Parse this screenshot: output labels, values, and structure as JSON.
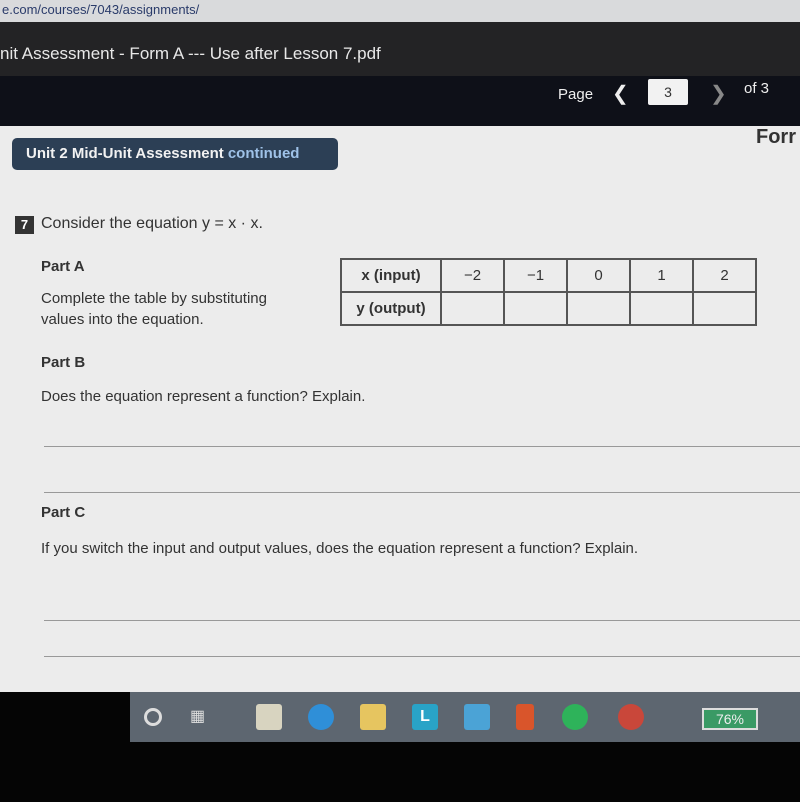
{
  "browser": {
    "url": "e.com/courses/7043/assignments/"
  },
  "viewer": {
    "title": "nit Assessment - Form A --- Use after Lesson 7.pdf",
    "page_label": "Page",
    "current_page": "3",
    "page_total": "of 3"
  },
  "doc": {
    "badge_title": "Unit 2  Mid-Unit Assessment",
    "badge_continued": "continued",
    "form_label": "Forr",
    "question_number": "7",
    "question": "Consider the equation y = x · x.",
    "part_a": {
      "label": "Part A",
      "text": "Complete the table by substituting values into the equation."
    },
    "table": {
      "row1_header": "x (input)",
      "row2_header": "y (output)",
      "x_values": [
        "−2",
        "−1",
        "0",
        "1",
        "2"
      ],
      "y_values": [
        "",
        "",
        "",
        "",
        ""
      ]
    },
    "part_b": {
      "label": "Part B",
      "text": "Does the equation represent a function? Explain."
    },
    "part_c": {
      "label": "Part C",
      "text": "If you switch the input and output values, does the equation represent a function? Explain."
    }
  },
  "taskbar": {
    "icons": [
      "cortana-icon",
      "task-view-icon",
      "store-icon",
      "edge-icon",
      "file-explorer-icon",
      "l-app-icon",
      "mail-icon",
      "office-icon",
      "spotify-icon",
      "chrome-icon"
    ],
    "battery": "76%"
  }
}
